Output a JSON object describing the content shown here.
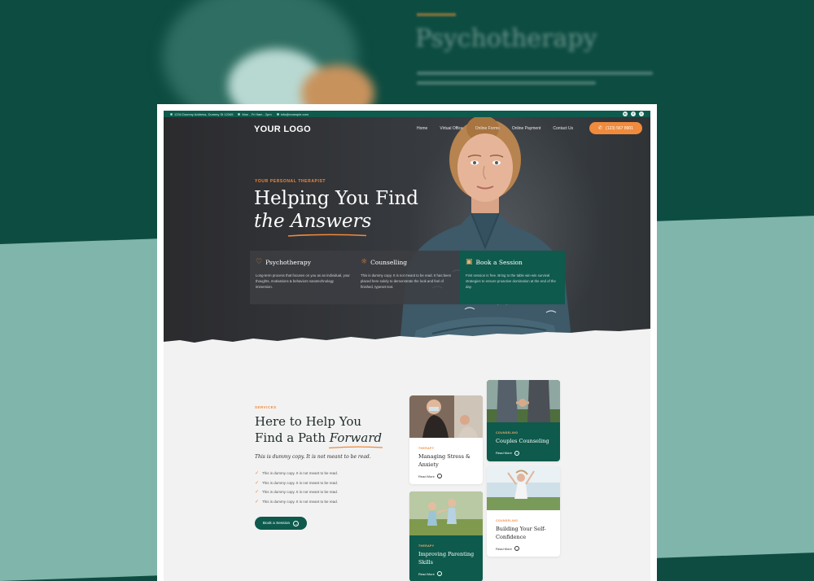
{
  "bg_ghost": {
    "title": "Psychotherapy"
  },
  "topbar": {
    "address": "1234 Dummy Address, Dummy St 12345",
    "hours": "Mon - Fri 9am - 2pm",
    "email": "info@example.com",
    "socials": [
      {
        "name": "linkedin-icon",
        "glyph": "in"
      },
      {
        "name": "facebook-icon",
        "glyph": "f"
      },
      {
        "name": "twitter-icon",
        "glyph": "t"
      }
    ]
  },
  "nav": {
    "logo": "YOUR LOGO",
    "items": [
      "Home",
      "Virtual Office",
      "Online Forms",
      "Online Payment",
      "Contact Us"
    ],
    "phone": "(123) 567 8901"
  },
  "hero": {
    "kicker": "YOUR PERSONAL THERAPIST",
    "title_line1": "Helping You Find",
    "title_line2_plain": "the ",
    "title_line2_accent": "Answers"
  },
  "services_row": [
    {
      "icon": "heart-icon",
      "title": "Psychotherapy",
      "text": "Long-term process that focuses on you as an individual, your thoughts, motivations & behaviors nanotechnology immersion."
    },
    {
      "icon": "sun-icon",
      "title": "Counselling",
      "text": "This is dummy copy. It is not meant to be read. It has been placed here solely to demonstrate the look and feel of finished, typeset text."
    },
    {
      "icon": "calendar-icon",
      "title": "Book a Session",
      "text": "First session is free. Bring to the table win-win survival strategies to ensure proactive domination at the end of the day."
    }
  ],
  "services": {
    "kicker": "SERVICES",
    "title_line1": "Here to Help You",
    "title_line2_plain": "Find a Path ",
    "title_line2_accent": "Forward",
    "subtitle": "This is dummy copy. It is not meant to be read.",
    "list": [
      "This is dummy copy. It is not meant to be read.",
      "This is dummy copy. It is not meant to be read.",
      "This is dummy copy. It is not meant to be read.",
      "This is dummy copy. It is not meant to be read."
    ],
    "button": "Book a Session"
  },
  "cards": [
    {
      "tag": "THERAPY",
      "title": "Managing Stress & Anxiety",
      "more": "Read More"
    },
    {
      "tag": "COUNSELING",
      "title": "Couples Counseling",
      "more": "Read More"
    },
    {
      "tag": "THERAPY",
      "title": "Improving Parenting Skills",
      "more": "Read More"
    },
    {
      "tag": "COUNSELING",
      "title": "Building Your Self-Confidence",
      "more": "Read More"
    }
  ],
  "colors": {
    "accent": "#f08a3c",
    "brand": "#0e5a4c",
    "hero_bg": "#35383c"
  }
}
